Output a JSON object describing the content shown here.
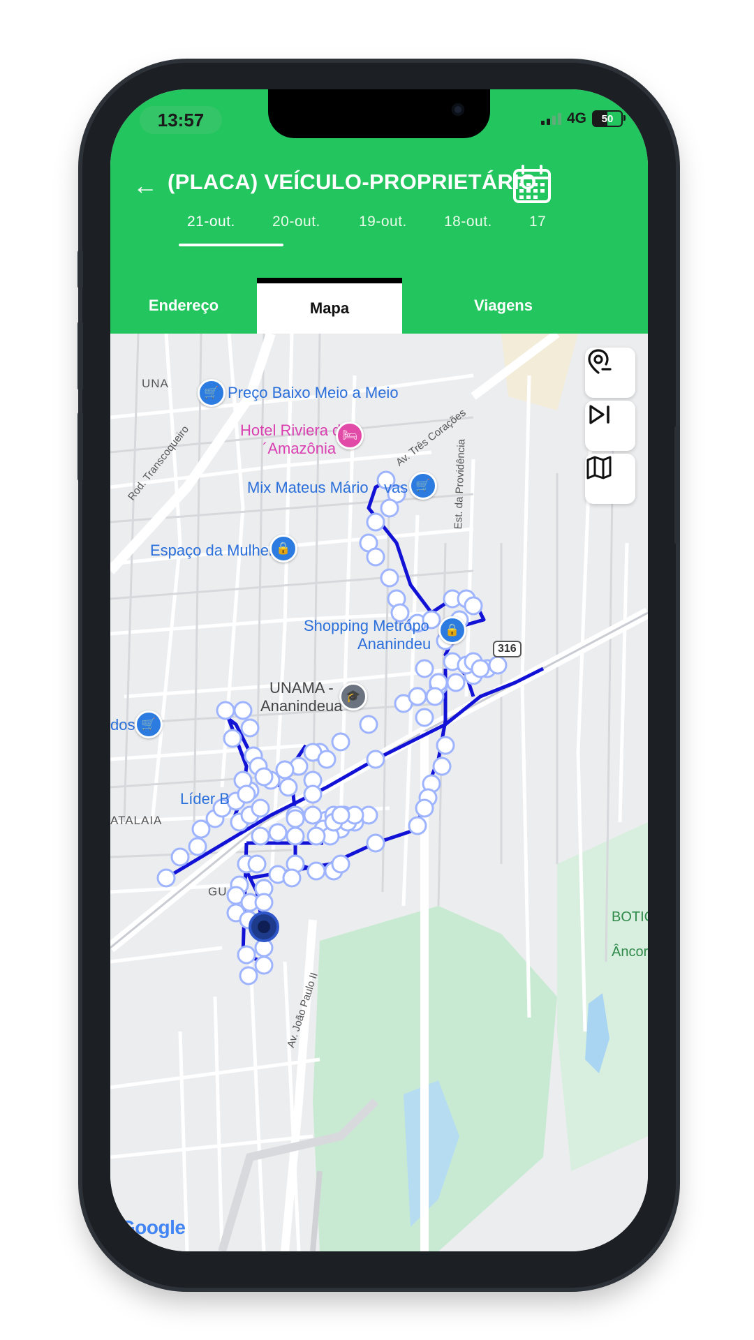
{
  "status_bar": {
    "time": "13:57",
    "network": "4G",
    "battery": "50"
  },
  "header": {
    "title": "(PLACA) VEÍCULO-PROPRIETÁRIO",
    "back_icon": "arrow-left-icon",
    "calendar_icon": "calendar-icon"
  },
  "dates": [
    "21-out.",
    "20-out.",
    "19-out.",
    "18-out.",
    "17"
  ],
  "selected_date": "21-out.",
  "tabs": [
    {
      "label": "Endereço"
    },
    {
      "label": "Mapa",
      "active": true
    },
    {
      "label": "Viagens"
    }
  ],
  "map": {
    "places": {
      "una": "UNA",
      "preco_baixo": "Preço Baixo Meio a Meio",
      "hotel_line1": "Hotel Riviera d",
      "hotel_line2": "´Amazônia",
      "mix_mateus": "Mix Mateus Mário ",
      "mix_mateus_tail": "vas",
      "espaco_mulher": "Espaço da Mulher",
      "shopping_line1": "Shopping Metrópo",
      "shopping_line2": "Ananindeu",
      "unama_line1": "UNAMA -",
      "unama_line2": "Ananindeua",
      "dos": "dos",
      "lider": "Líder B",
      "atalaia": "ATALAIA",
      "gu": "GU",
      "botic": "BOTIC",
      "ancor": "Âncor",
      "route_shield": "316"
    },
    "roads": {
      "transcoqueiro": "Rod. Transcoqueiro",
      "tres_coracoes": "Av. Três Corações",
      "providencia": "Est. da Providência",
      "joao_paulo": "Av. João Paulo II"
    },
    "attribution": "Google",
    "controls": [
      "location-marker-icon",
      "play-skip-icon",
      "map-icon"
    ],
    "colors": {
      "route": "#1212d6",
      "point_fill": "#ffffff",
      "point_stroke": "#8aa4ff",
      "current": "#1e3a8a"
    }
  }
}
